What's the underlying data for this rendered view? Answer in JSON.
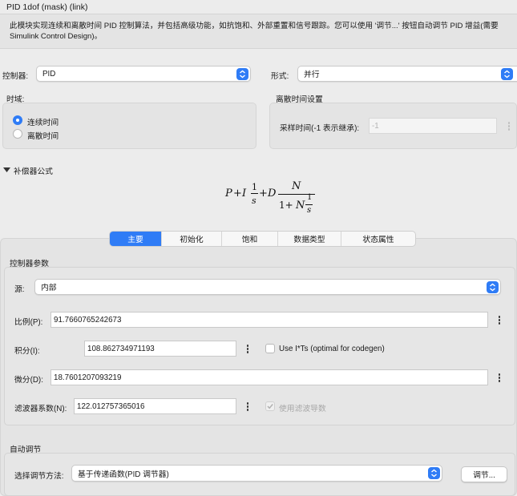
{
  "header": {
    "title": "PID 1dof (mask) (link)",
    "description": "此模块实现连续和离散时间 PID 控制算法，并包括高级功能，如抗饱和、外部重置和信号跟踪。您可以使用 '调节...' 按钮自动调节 PID 增益(需要 Simulink Control Design)。"
  },
  "controller": {
    "label": "控制器:",
    "value": "PID"
  },
  "form": {
    "label": "形式:",
    "value": "并行"
  },
  "time_domain": {
    "label": "时域:",
    "options": [
      "连续时间",
      "离散时间"
    ],
    "selected": "连续时间"
  },
  "discrete_settings": {
    "label": "离散时间设置",
    "sample_time_label": "采样时间(-1 表示继承):",
    "sample_time_value": "-1"
  },
  "compensator": {
    "label": "补偿器公式",
    "formula": {
      "P": "P",
      "plus": "+",
      "I": "I",
      "one": "1",
      "s": "s",
      "D": "D",
      "N": "N",
      "one_plus": "1+"
    }
  },
  "tabs": [
    "主要",
    "初始化",
    "饱和",
    "数据类型",
    "状态属性"
  ],
  "active_tab": "主要",
  "params": {
    "section_label": "控制器参数",
    "source_label": "源:",
    "source_value": "内部",
    "p_label": "比例(P):",
    "p_value": "91.7660765242673",
    "i_label": "积分(I):",
    "i_value": "108.862734971193",
    "its_label": "Use I*Ts (optimal for codegen)",
    "d_label": "微分(D):",
    "d_value": "18.7601207093219",
    "n_label": "滤波器系数(N):",
    "n_value": "122.012757365016",
    "use_filter_label": "使用滤波导数"
  },
  "autotune": {
    "section_label": "自动调节",
    "method_label": "选择调节方法:",
    "method_value": "基于传递函数(PID 调节器)",
    "tune_button": "调节..."
  },
  "colors": {
    "accent": "#2f7cf6",
    "panel": "#e4e4e4",
    "background": "#ececec"
  }
}
